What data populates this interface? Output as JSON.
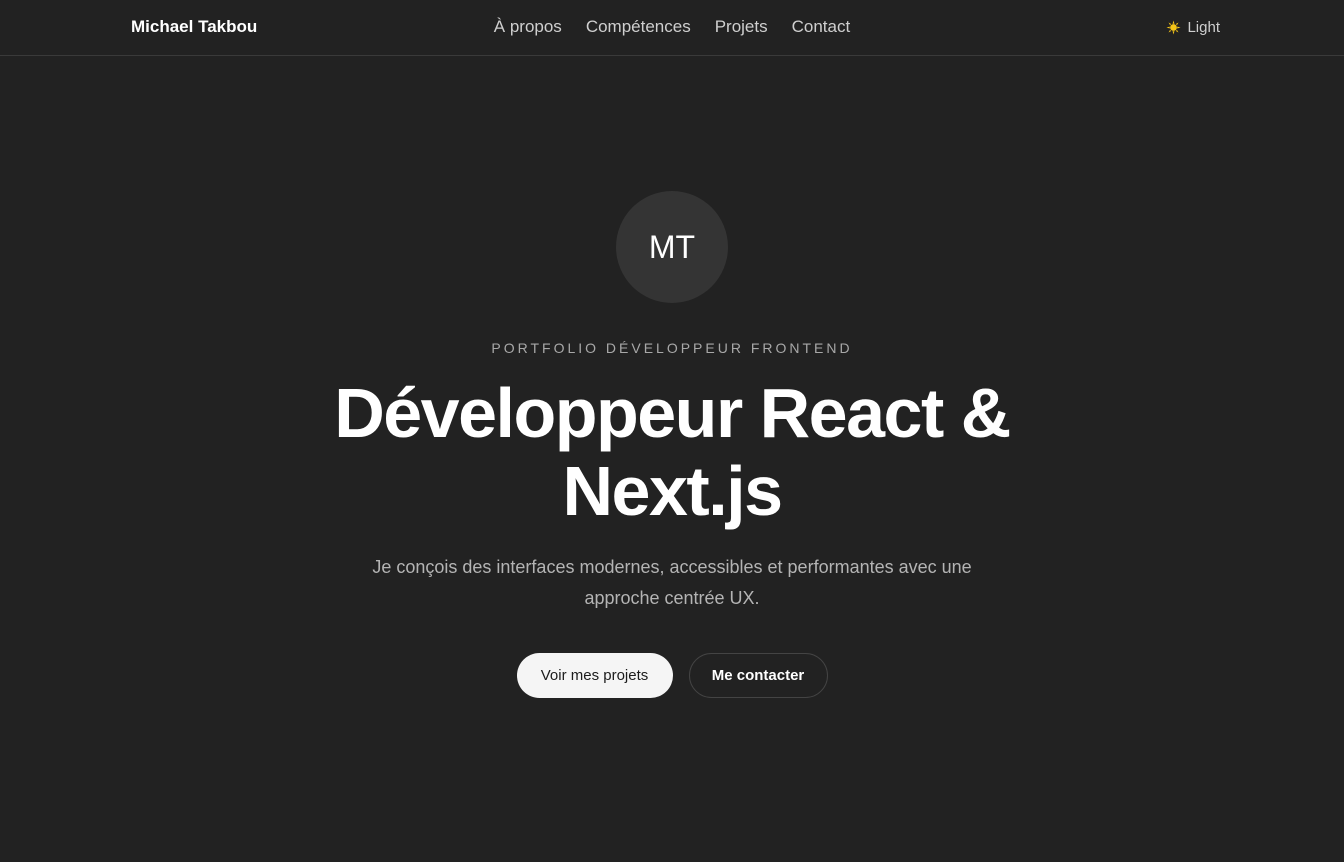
{
  "header": {
    "brand": "Michael Takbou",
    "nav": [
      "À propos",
      "Compétences",
      "Projets",
      "Contact"
    ],
    "theme_toggle": {
      "icon": "sun-icon",
      "label": "Light"
    }
  },
  "hero": {
    "avatar_initials": "MT",
    "eyebrow": "PORTFOLIO DÉVELOPPEUR FRONTEND",
    "headline": "Développeur React & Next.js",
    "subtitle": "Je conçois des interfaces modernes, accessibles et performantes avec une approche centrée UX.",
    "primary_cta": "Voir mes projets",
    "secondary_cta": "Me contacter"
  },
  "colors": {
    "background": "#222222",
    "accent_sun": "#f5c518",
    "primary_button_bg": "#f5f5f5"
  }
}
